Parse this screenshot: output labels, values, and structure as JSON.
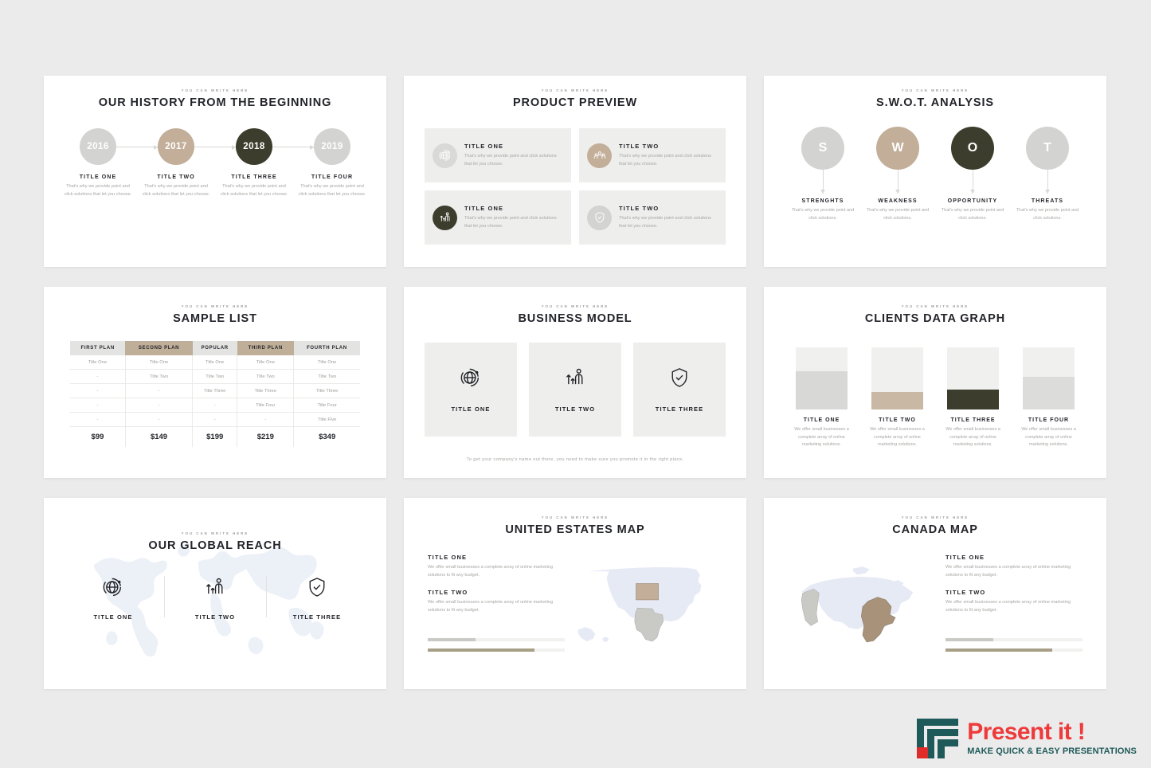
{
  "theme": {
    "page_bg": "#ebebeb",
    "slide_bg": "#ffffff",
    "gray": "#d3d3d1",
    "tan": "#c2ae99",
    "dark": "#3c3d2c",
    "light_gray": "#dcdcda",
    "text_dark": "#23242a",
    "text_muted": "#a6a6a3"
  },
  "common": {
    "eyebrow": "YOU CAN WRITE HERE"
  },
  "slides": {
    "history": {
      "eyebrow": "YOU CAN WRITE HERE",
      "title": "OUR HISTORY FROM THE BEGINNING",
      "items": [
        {
          "year": "2016",
          "title": "TITLE ONE",
          "desc": "That's why we provide point and click solutions that let you choose.",
          "color": "#d3d3d1"
        },
        {
          "year": "2017",
          "title": "TITLE TWO",
          "desc": "That's why we provide point and click solutions that let you choose.",
          "color": "#c2ae99"
        },
        {
          "year": "2018",
          "title": "TITLE THREE",
          "desc": "That's why we provide point and click solutions that let you choose.",
          "color": "#3c3d2c"
        },
        {
          "year": "2019",
          "title": "TITLE FOUR",
          "desc": "That's why we provide point and click solutions that let you choose.",
          "color": "#d3d3d1"
        }
      ]
    },
    "product": {
      "eyebrow": "YOU CAN WRITE HERE",
      "title": "PRODUCT PREVIEW",
      "cards": [
        {
          "title": "TITLE ONE",
          "desc": "That's why we provide point and click solutions that let you choose.",
          "icon": "globe-icon",
          "color": "#d9d9d7"
        },
        {
          "title": "TITLE TWO",
          "desc": "That's why we provide point and click solutions that let you choose.",
          "icon": "people-icon",
          "color": "#c2ae99"
        },
        {
          "title": "TITLE ONE",
          "desc": "That's why we provide point and click solutions that let you choose.",
          "icon": "growth-icon",
          "color": "#3c3d2c"
        },
        {
          "title": "TITLE TWO",
          "desc": "That's why we provide point and click solutions that let you choose.",
          "icon": "shield-icon",
          "color": "#d3d3d1"
        }
      ]
    },
    "swot": {
      "eyebrow": "YOU CAN WRITE HERE",
      "title": "S.W.O.T. ANALYSIS",
      "items": [
        {
          "letter": "S",
          "title": "STRENGHTS",
          "desc": "That's why we provide point and click solutions.",
          "color": "#d3d3d1"
        },
        {
          "letter": "W",
          "title": "WEAKNESS",
          "desc": "That's why we provide point and click solutions.",
          "color": "#c2ae99"
        },
        {
          "letter": "O",
          "title": "OPPORTUNITY",
          "desc": "That's why we provide point and click solutions.",
          "color": "#3c3d2c"
        },
        {
          "letter": "T",
          "title": "THREATS",
          "desc": "That's why we provide point and click solutions.",
          "color": "#d3d3d1"
        }
      ]
    },
    "sample_list": {
      "eyebrow": "YOU CAN WRITE HERE",
      "title": "SAMPLE LIST",
      "headers": [
        {
          "label": "FIRST PLAN",
          "style": "gray"
        },
        {
          "label": "SECOND PLAN",
          "style": "tan"
        },
        {
          "label": "POPULAR",
          "style": "gray"
        },
        {
          "label": "THIRD PLAN",
          "style": "tan"
        },
        {
          "label": "FOURTH PLAN",
          "style": "gray"
        }
      ],
      "rows": [
        [
          "Title One",
          "Title One",
          "Title One",
          "Title One",
          "Title One"
        ],
        [
          "-",
          "Title Two",
          "Title Two",
          "Title Two",
          "Title Two"
        ],
        [
          "-",
          "-",
          "Title Three",
          "Title Three",
          "Title Three"
        ],
        [
          "-",
          "-",
          "-",
          "Title Four",
          "Title Four"
        ],
        [
          "-",
          "-",
          "-",
          "-",
          "Title Five"
        ]
      ],
      "prices": [
        "$99",
        "$149",
        "$199",
        "$219",
        "$349"
      ]
    },
    "business_model": {
      "eyebrow": "YOU CAN WRITE HERE",
      "title": "BUSINESS MODEL",
      "cards": [
        {
          "title": "TITLE ONE",
          "icon": "globe-icon"
        },
        {
          "title": "TITLE TWO",
          "icon": "growth-icon"
        },
        {
          "title": "TITLE THREE",
          "icon": "shield-icon"
        }
      ],
      "footer": "To get your company's name out there, you need to make sure you promote it in the right place."
    },
    "clients_graph": {
      "eyebrow": "YOU CAN WRITE HERE",
      "title": "CLIENTS DATA GRAPH"
    },
    "global_reach": {
      "eyebrow": "YOU CAN WRITE HERE",
      "title": "OUR GLOBAL REACH",
      "items": [
        {
          "title": "TITLE ONE",
          "icon": "globe-icon"
        },
        {
          "title": "TITLE TWO",
          "icon": "growth-icon"
        },
        {
          "title": "TITLE THREE",
          "icon": "shield-icon"
        }
      ]
    },
    "us_map": {
      "eyebrow": "YOU CAN WRITE HERE",
      "title": "UNITED ESTATES MAP",
      "blocks": [
        {
          "title": "TITLE ONE",
          "desc": "We offer small businesses a complete array of online marketing solutions to fit any budget."
        },
        {
          "title": "TITLE TWO",
          "desc": "We offer small businesses a complete array of online marketing solutions to fit any budget."
        }
      ],
      "bars": [
        {
          "percent": 35,
          "color": "#c9c9c6"
        },
        {
          "percent": 78,
          "color": "#a79f86"
        }
      ]
    },
    "canada_map": {
      "eyebrow": "YOU CAN WRITE HERE",
      "title": "CANADA MAP",
      "blocks": [
        {
          "title": "TITLE ONE",
          "desc": "We offer small businesses a complete array of online marketing solutions to fit any budget."
        },
        {
          "title": "TITLE TWO",
          "desc": "We offer small businesses a complete array of online marketing solutions to fit any budget."
        }
      ],
      "bars": [
        {
          "percent": 35,
          "color": "#c9c9c6"
        },
        {
          "percent": 78,
          "color": "#a79f86"
        }
      ]
    }
  },
  "chart_data": {
    "type": "bar",
    "title": "CLIENTS DATA GRAPH",
    "categories": [
      "TITLE ONE",
      "TITLE TWO",
      "TITLE THREE",
      "TITLE FOUR"
    ],
    "values": [
      62,
      28,
      32,
      52
    ],
    "ylim": [
      0,
      100
    ],
    "xlabel": "",
    "ylabel": "",
    "grid": false,
    "legend": "none",
    "colors": [
      "#d8d8d6",
      "#c9b8a3",
      "#3c3d2c",
      "#dcdcda"
    ],
    "track_color": "#f0f0ee",
    "descriptions": [
      "We offer small businesses a complete array of online marketing solutions.",
      "We offer small businesses a complete array of online marketing solutions.",
      "We offer small businesses a complete array of online marketing solutions.",
      "We offer small businesses a complete array of online marketing solutions."
    ]
  },
  "logo": {
    "main": "Present it !",
    "tagline": "MAKE QUICK & EASY PRESENTATIONS",
    "red": "#ee3a3a",
    "teal": "#1f5a5a"
  }
}
